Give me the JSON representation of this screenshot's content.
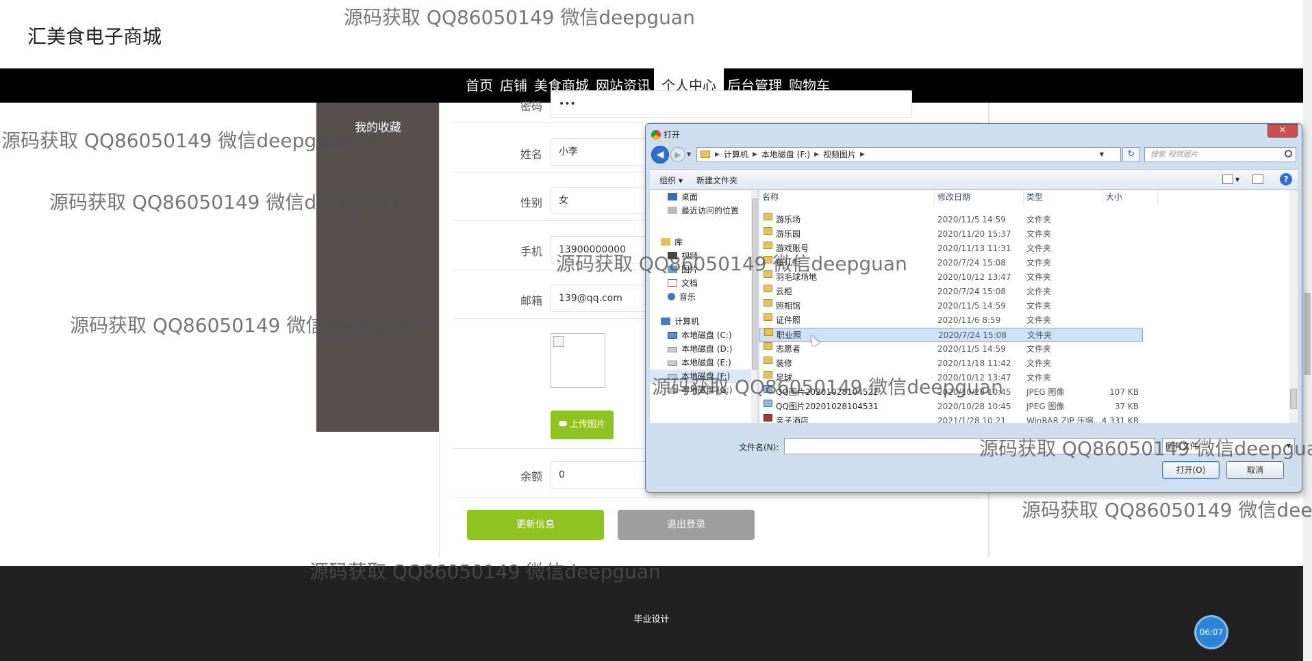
{
  "site": {
    "title": "汇美食电子商城"
  },
  "nav": {
    "items": [
      {
        "label": "首页",
        "active": false
      },
      {
        "label": "店铺",
        "active": false
      },
      {
        "label": "美食商城",
        "active": false
      },
      {
        "label": "网站资讯",
        "active": false
      },
      {
        "label": "个人中心",
        "active": true
      },
      {
        "label": "后台管理",
        "active": false
      },
      {
        "label": "购物车",
        "active": false
      }
    ]
  },
  "sidebar": {
    "items": [
      {
        "label": "我的收藏"
      }
    ]
  },
  "form": {
    "password": {
      "label": "密码",
      "value": "•••"
    },
    "name": {
      "label": "姓名",
      "value": "小李"
    },
    "gender": {
      "label": "性别",
      "value": "女"
    },
    "phone": {
      "label": "手机",
      "value": "13900000000"
    },
    "email": {
      "label": "邮箱",
      "value": "139@qq.com"
    },
    "upload_label": "上传图片",
    "balance": {
      "label": "余额",
      "value": "0"
    },
    "update_label": "更新信息",
    "logout_label": "退出登录"
  },
  "footer": {
    "text": "毕业设计",
    "timer": "06:07"
  },
  "watermark": "源码获取 QQ86050149 微信deepguan",
  "dialog": {
    "title": "打开",
    "close": "✕",
    "breadcrumbs": [
      "计算机",
      "本地磁盘 (F:)",
      "视频图片"
    ],
    "search_placeholder": "搜索 视频图片",
    "toolbar": {
      "organize": "组织 ▾",
      "new_folder": "新建文件夹",
      "help": "?"
    },
    "tree": [
      {
        "label": "桌面",
        "icon": "desktop-icon"
      },
      {
        "label": "最近访问的位置",
        "icon": "recent-icon"
      },
      {
        "label": "库",
        "icon": "library-icon"
      },
      {
        "label": "视频",
        "icon": "video-icon"
      },
      {
        "label": "图片",
        "icon": "picture-icon"
      },
      {
        "label": "文档",
        "icon": "document-icon"
      },
      {
        "label": "音乐",
        "icon": "music-icon"
      },
      {
        "label": "计算机",
        "icon": "computer-icon"
      },
      {
        "label": "本地磁盘 (C:)",
        "icon": "disk-icon"
      },
      {
        "label": "本地磁盘 (D:)",
        "icon": "disk-icon"
      },
      {
        "label": "本地磁盘 (E:)",
        "icon": "disk-icon"
      },
      {
        "label": "本地磁盘 (F:)",
        "icon": "disk-icon",
        "selected": true
      },
      {
        "label": "本地磁盘 (G:)",
        "icon": "disk-icon"
      }
    ],
    "columns": {
      "name": "名称",
      "date": "修改日期",
      "type": "类型",
      "size": "大小"
    },
    "files": [
      {
        "name": "游乐场",
        "date": "2020/11/5 14:59",
        "type": "文件夹",
        "size": "",
        "kind": "folder"
      },
      {
        "name": "游乐园",
        "date": "2020/11/20 15:37",
        "type": "文件夹",
        "size": "",
        "kind": "folder"
      },
      {
        "name": "游戏账号",
        "date": "2020/11/13 11:31",
        "type": "文件夹",
        "size": "",
        "kind": "folder"
      },
      {
        "name": "鱼儿街",
        "date": "2020/7/24 15:08",
        "type": "文件夹",
        "size": "",
        "kind": "folder"
      },
      {
        "name": "羽毛球场地",
        "date": "2020/10/12 13:47",
        "type": "文件夹",
        "size": "",
        "kind": "folder"
      },
      {
        "name": "云柜",
        "date": "2020/7/24 15:08",
        "type": "文件夹",
        "size": "",
        "kind": "folder"
      },
      {
        "name": "照相馆",
        "date": "2020/11/5 14:59",
        "type": "文件夹",
        "size": "",
        "kind": "folder"
      },
      {
        "name": "证件照",
        "date": "2020/11/6 8:59",
        "type": "文件夹",
        "size": "",
        "kind": "folder"
      },
      {
        "name": "职业照",
        "date": "2020/7/24 15:08",
        "type": "文件夹",
        "size": "",
        "kind": "folder",
        "selected": true
      },
      {
        "name": "志愿者",
        "date": "2020/11/5 14:59",
        "type": "文件夹",
        "size": "",
        "kind": "folder"
      },
      {
        "name": "装修",
        "date": "2020/11/18 11:42",
        "type": "文件夹",
        "size": "",
        "kind": "folder"
      },
      {
        "name": "足球",
        "date": "2020/10/12 13:47",
        "type": "文件夹",
        "size": "",
        "kind": "folder"
      },
      {
        "name": "QQ图片20201028104522",
        "date": "2020/10/28 10:45",
        "type": "JPEG 图像",
        "size": "107 KB",
        "kind": "image"
      },
      {
        "name": "QQ图片20201028104531",
        "date": "2020/10/28 10:45",
        "type": "JPEG 图像",
        "size": "37 KB",
        "kind": "image"
      },
      {
        "name": "亲子酒店",
        "date": "2021/1/28 10:21",
        "type": "WinRAR ZIP 压缩...",
        "size": "4,331 KB",
        "kind": "zip"
      }
    ],
    "filename_label": "文件名(N):",
    "filename_value": "",
    "filetype": "所有文件",
    "open_label": "打开(O)",
    "cancel_label": "取消"
  }
}
